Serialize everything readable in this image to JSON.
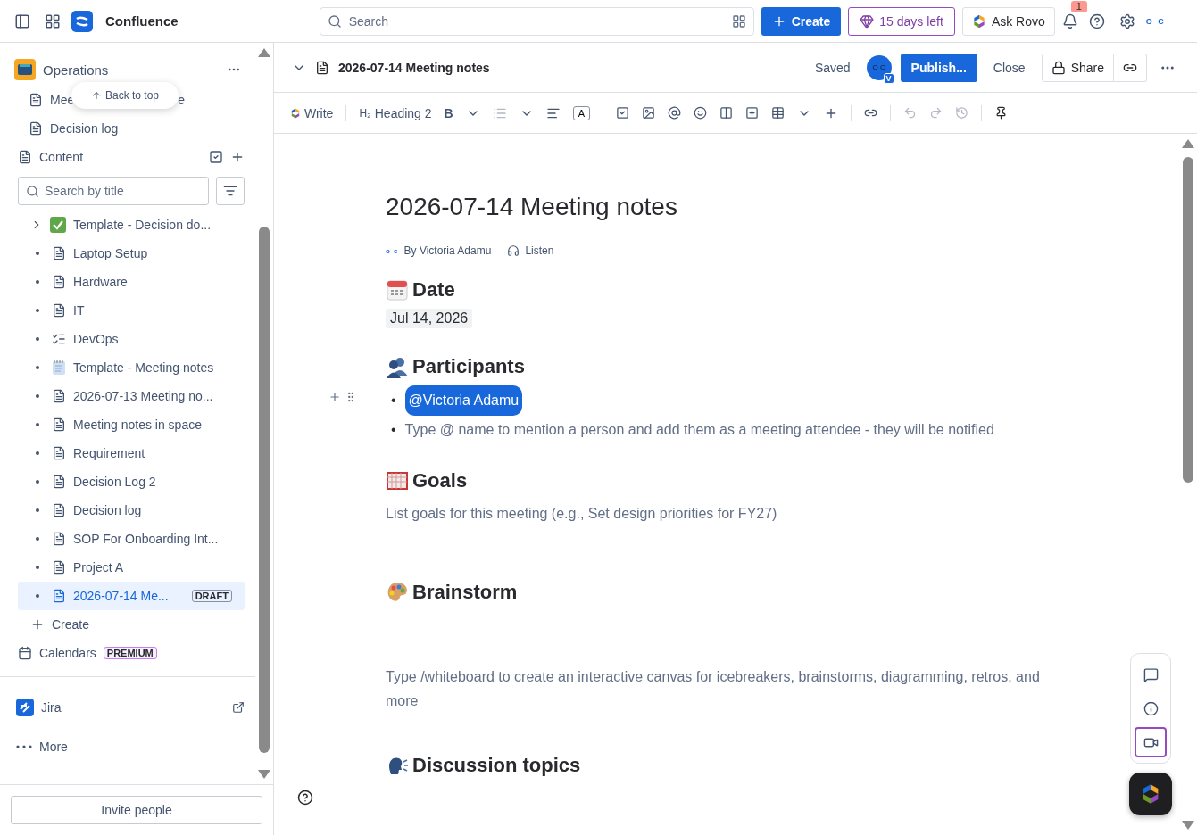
{
  "topbar": {
    "product": "Confluence",
    "search_placeholder": "Search",
    "create": "Create",
    "trial": "15 days left",
    "ask": "Ask Rovo",
    "notifications": "1",
    "avatar": "O C"
  },
  "sidebar": {
    "space": "Operations",
    "pinned": [
      {
        "label": "Mee",
        "tail": "e"
      },
      {
        "label": "Decision log"
      }
    ],
    "back_to_top": "Back to top",
    "content_label": "Content",
    "search_placeholder": "Search by title",
    "tree": [
      {
        "kind": "done",
        "label": "Template - Decision do...",
        "expandable": true,
        "selected": false
      },
      {
        "kind": "page",
        "label": "Laptop Setup",
        "expandable": false,
        "selected": false
      },
      {
        "kind": "page",
        "label": "Hardware",
        "expandable": false,
        "selected": false
      },
      {
        "kind": "page",
        "label": "IT",
        "expandable": false,
        "selected": false
      },
      {
        "kind": "list",
        "label": "DevOps",
        "expandable": false,
        "selected": false
      },
      {
        "kind": "notepad",
        "label": "Template - Meeting notes",
        "expandable": false,
        "selected": false
      },
      {
        "kind": "page",
        "label": "2026-07-13 Meeting no...",
        "expandable": false,
        "selected": false
      },
      {
        "kind": "page",
        "label": "Meeting notes in space",
        "expandable": false,
        "selected": false
      },
      {
        "kind": "page",
        "label": "Requirement",
        "expandable": false,
        "selected": false
      },
      {
        "kind": "page",
        "label": "Decision Log 2",
        "expandable": false,
        "selected": false
      },
      {
        "kind": "page",
        "label": "Decision log",
        "expandable": false,
        "selected": false
      },
      {
        "kind": "page",
        "label": "SOP For Onboarding Int...",
        "expandable": false,
        "selected": false
      },
      {
        "kind": "page",
        "label": "Project A",
        "expandable": false,
        "selected": false
      },
      {
        "kind": "page",
        "label": "2026-07-14 Me...",
        "expandable": false,
        "selected": true,
        "badge": "DRAFT"
      }
    ],
    "create": "Create",
    "calendars": "Calendars",
    "premium": "PREMIUM",
    "apps": [
      {
        "kind": "jira",
        "label": "Jira"
      },
      {
        "kind": "more",
        "label": "More"
      }
    ],
    "invite": "Invite people"
  },
  "page_header": {
    "title": "2026-07-14 Meeting notes",
    "status": "Saved",
    "avatar": "O C",
    "avatar_badge": "V",
    "publish": "Publish...",
    "close": "Close",
    "share": "Share"
  },
  "toolbar": {
    "write": "Write",
    "heading": "Heading 2",
    "heading_mark": "H₂",
    "bold": "B",
    "text_style": "A"
  },
  "document": {
    "title": "2026-07-14 Meeting notes",
    "author_avatar": "o c",
    "byline": "By Victoria Adamu",
    "listen": "Listen",
    "sections": [
      {
        "kind": "date",
        "heading": "Date",
        "date": "Jul 14, 2026"
      },
      {
        "kind": "participants",
        "heading": "Participants",
        "bullet": "•",
        "mention": "@Victoria Adamu",
        "hint": "Type @ name to mention a person and add them as a meeting attendee - they will be notified"
      },
      {
        "kind": "goals",
        "heading": "Goals",
        "text": "List goals for this meeting (e.g., Set design priorities for FY27)"
      },
      {
        "kind": "brainstorm",
        "heading": "Brainstorm",
        "text": "Type /whiteboard to create an interactive canvas for icebreakers, brainstorms, diagramming, retros, and more"
      },
      {
        "kind": "discussion",
        "heading": "Discussion topics"
      }
    ]
  }
}
